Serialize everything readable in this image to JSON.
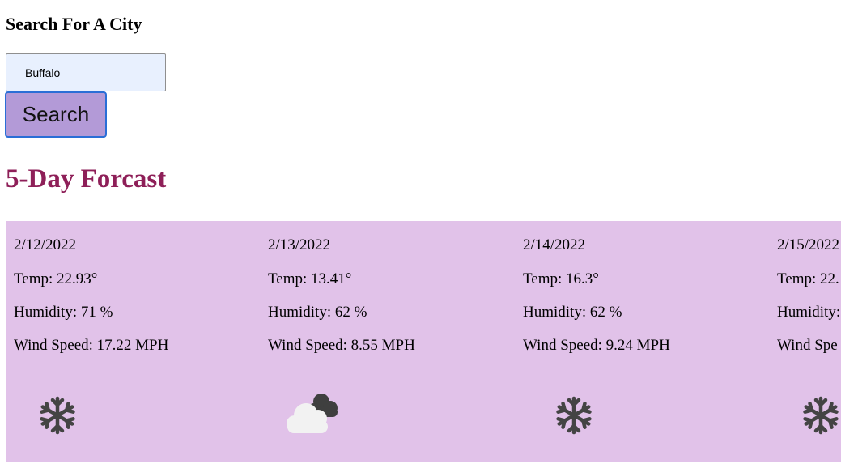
{
  "search": {
    "heading": "Search For A City",
    "input_value": "Buffalo",
    "button_label": "Search"
  },
  "forecast": {
    "heading": "5-Day Forcast",
    "colors": {
      "strip_background": "#e1c2e9",
      "heading": "#8e1f58",
      "button_background": "#b39ad7",
      "button_border": "#2a6ed6",
      "input_background": "#e8f0fe"
    },
    "days": [
      {
        "date": "2/12/2022",
        "temp": "Temp: 22.93°",
        "humidity": "Humidity: 71 %",
        "wind": "Wind Speed: 17.22 MPH",
        "icon": "snow-icon"
      },
      {
        "date": "2/13/2022",
        "temp": "Temp: 13.41°",
        "humidity": "Humidity: 62 %",
        "wind": "Wind Speed: 8.55 MPH",
        "icon": "cloudy-icon"
      },
      {
        "date": "2/14/2022",
        "temp": "Temp: 16.3°",
        "humidity": "Humidity: 62 %",
        "wind": "Wind Speed: 9.24 MPH",
        "icon": "snow-icon"
      },
      {
        "date": "2/15/2022",
        "temp": "Temp: 22.",
        "humidity": "Humidity:",
        "wind": "Wind Spe",
        "icon": "snow-icon"
      }
    ]
  }
}
